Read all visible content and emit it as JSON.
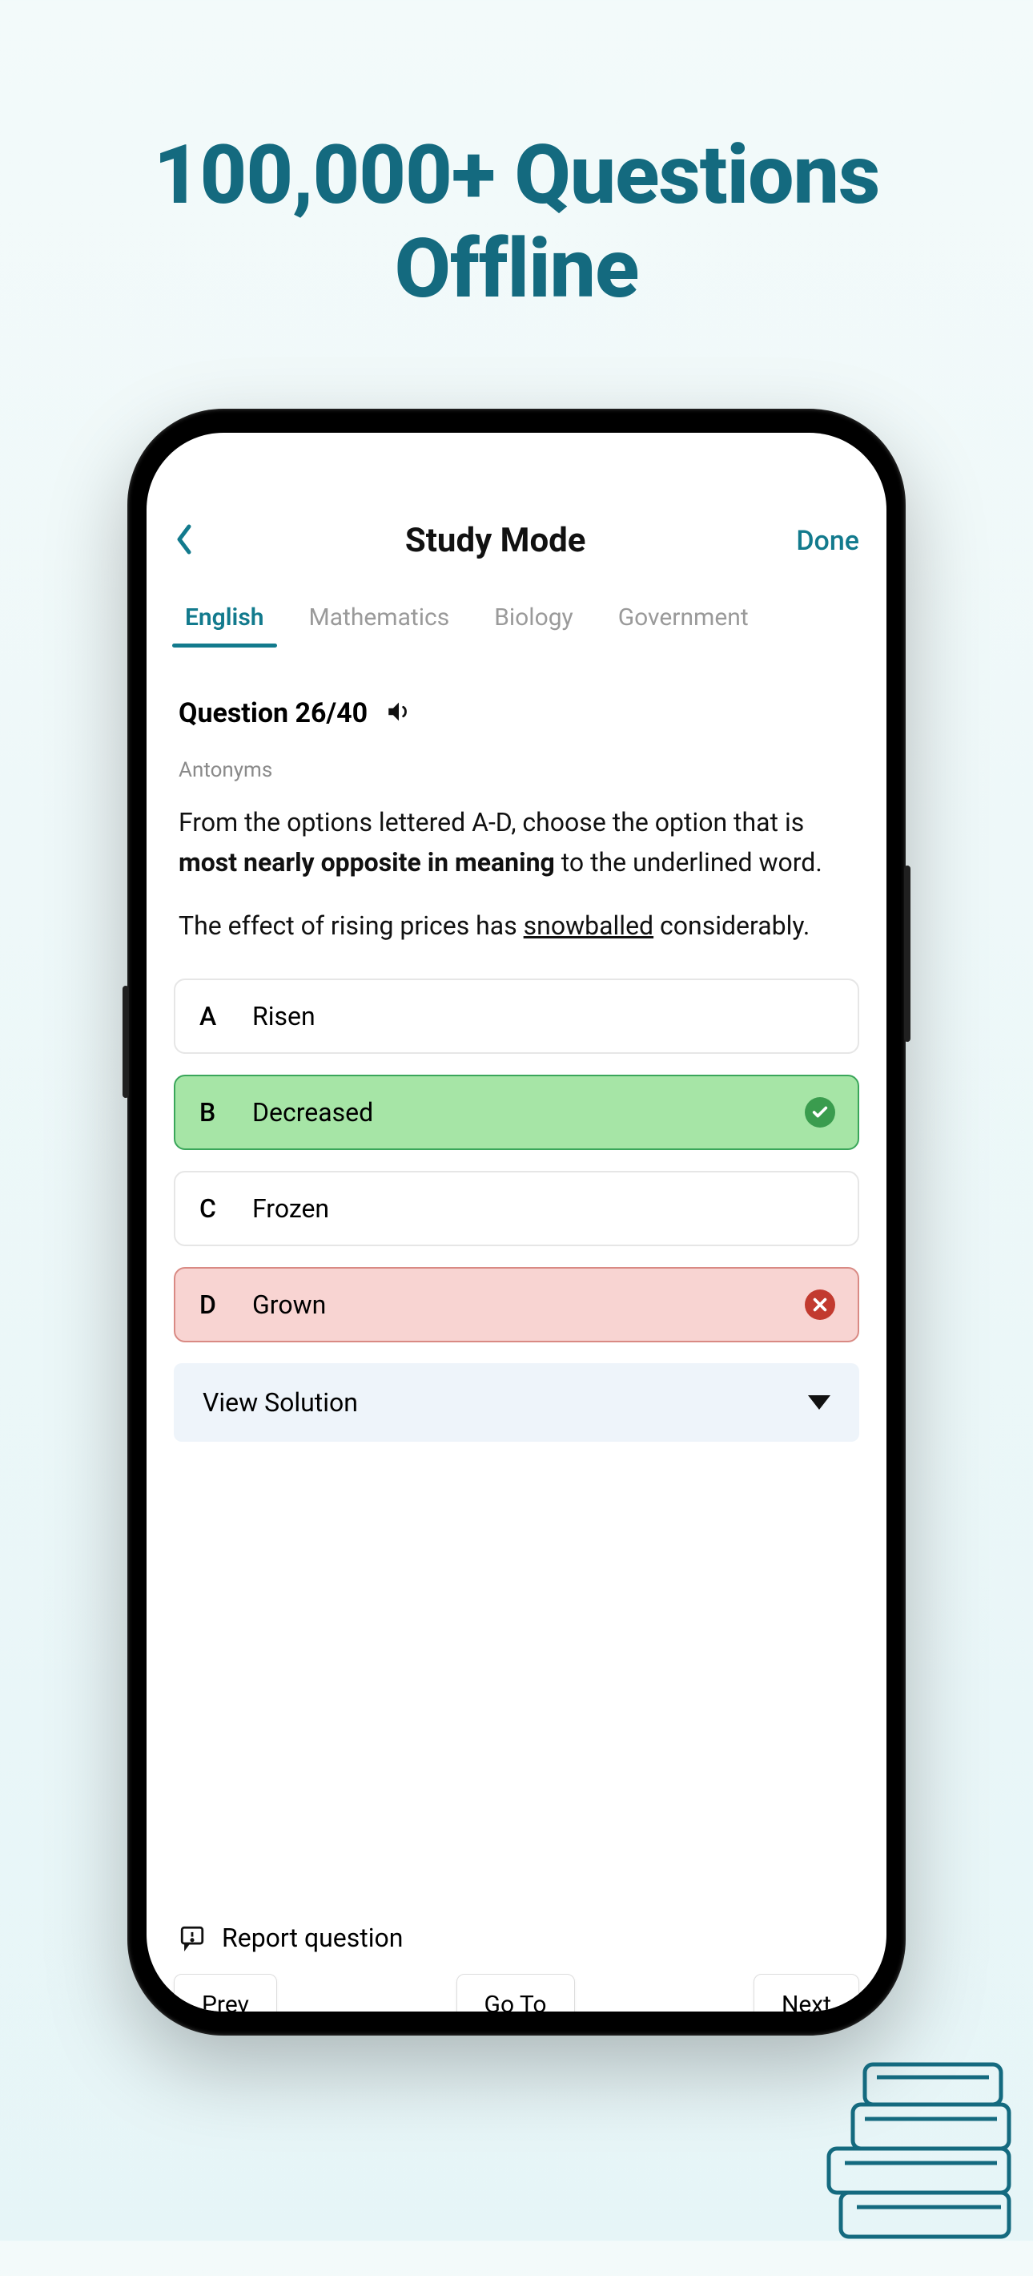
{
  "headline_line1": "100,000+ Questions",
  "headline_line2": "Offline",
  "header": {
    "title": "Study Mode",
    "done": "Done"
  },
  "tabs": [
    {
      "label": "English",
      "active": true
    },
    {
      "label": "Mathematics",
      "active": false
    },
    {
      "label": "Biology",
      "active": false
    },
    {
      "label": "Government",
      "active": false
    }
  ],
  "question": {
    "counter": "Question 26/40",
    "topic": "Antonyms",
    "prompt_pre": "From the options lettered A-D, choose the option that is ",
    "prompt_bold": "most nearly opposite in meaning",
    "prompt_post": " to the underlined word.",
    "sentence_pre": "The effect of rising prices has ",
    "sentence_underlined": "snowballed",
    "sentence_post": " considerably."
  },
  "options": [
    {
      "letter": "A",
      "text": "Risen",
      "state": "neutral"
    },
    {
      "letter": "B",
      "text": "Decreased",
      "state": "correct"
    },
    {
      "letter": "C",
      "text": "Frozen",
      "state": "neutral"
    },
    {
      "letter": "D",
      "text": "Grown",
      "state": "wrong"
    }
  ],
  "solution_label": "View Solution",
  "report_label": "Report question",
  "nav": {
    "prev": "Prev",
    "goto": "Go To",
    "next": "Next"
  },
  "colors": {
    "accent": "#127a8d",
    "correct_bg": "#a6e5a6",
    "wrong_bg": "#f8d4d2"
  }
}
